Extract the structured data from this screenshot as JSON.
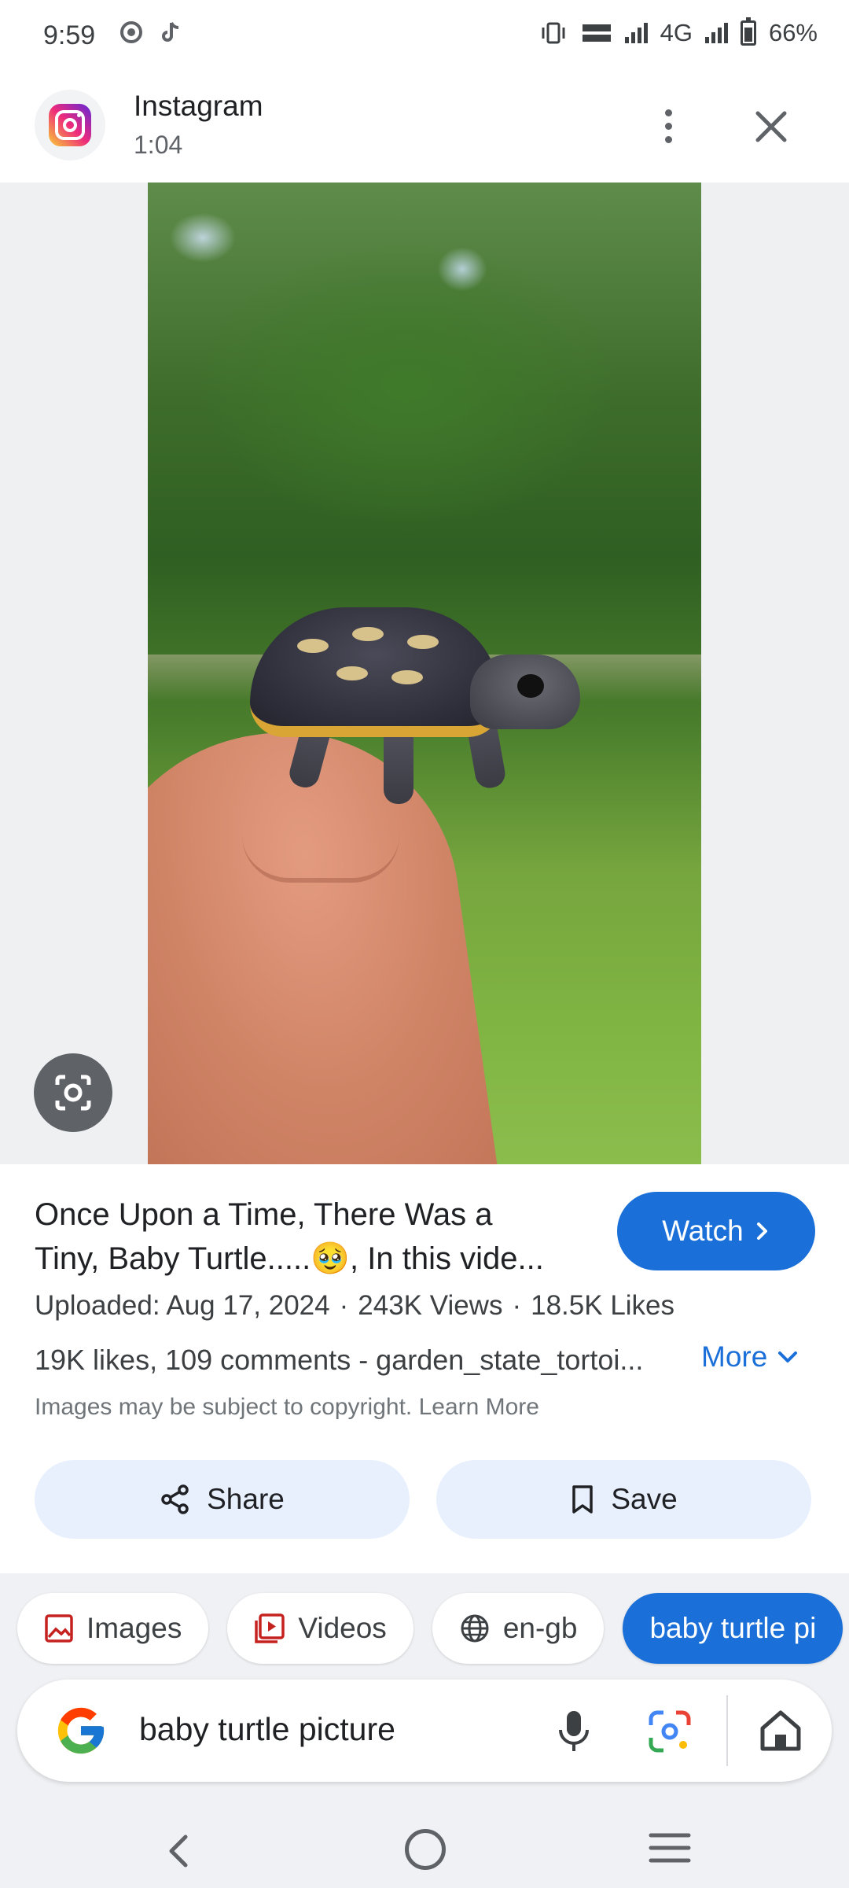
{
  "status_bar": {
    "time": "9:59",
    "network_label": "4G",
    "battery": "66%"
  },
  "source": {
    "name": "Instagram",
    "duration": "1:04"
  },
  "result": {
    "title_line1": "Once Upon a Time, There Was a",
    "title_line2": "Tiny, Baby Turtle.....🥹, In this vide...",
    "watch_label": "Watch",
    "uploaded": "Uploaded: Aug 17, 2024",
    "views": "243K Views",
    "likes": "18.5K Likes",
    "meta_separator": "·",
    "description": "19K likes, 109 comments - garden_state_tortoi...",
    "more_label": "More",
    "copyright": "Images may be subject to copyright. Learn More",
    "share_label": "Share",
    "save_label": "Save"
  },
  "chips": {
    "images": "Images",
    "videos": "Videos",
    "language": "en-gb",
    "query_chip": "baby turtle pi"
  },
  "search": {
    "query": "baby turtle picture"
  },
  "colors": {
    "accent": "#1a6fd8",
    "chip_active": "#1a6fd8",
    "pill_bg": "#e8f0fe",
    "images_icon": "#c5221f",
    "videos_icon": "#c5221f"
  },
  "icons": {
    "source_logo": "instagram-icon",
    "more": "more-vert-icon",
    "close": "close-icon",
    "lens": "google-lens-icon",
    "share": "share-icon",
    "save": "bookmark-icon",
    "mic": "mic-icon",
    "home": "home-icon"
  }
}
